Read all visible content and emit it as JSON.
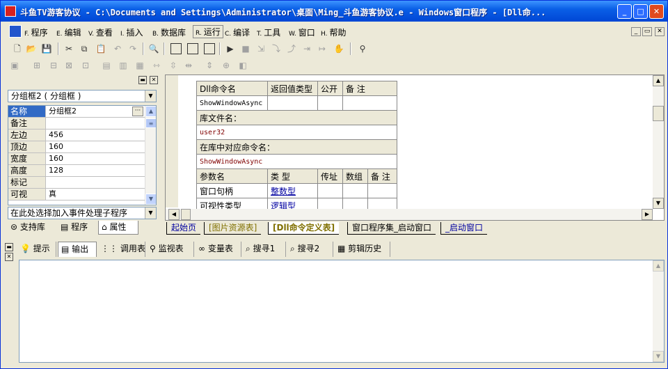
{
  "window": {
    "title": "斗鱼TV游客协议 - C:\\Documents and Settings\\Administrator\\桌面\\Ming_斗鱼游客协议.e - Windows窗口程序 - [Dll命..."
  },
  "menu": [
    {
      "key": "F.",
      "label": "程序"
    },
    {
      "key": "E.",
      "label": "编辑"
    },
    {
      "key": "V.",
      "label": "查看"
    },
    {
      "key": "I.",
      "label": "插入"
    },
    {
      "key": "B.",
      "label": "数据库"
    },
    {
      "key": "R.",
      "label": "运行"
    },
    {
      "key": "C.",
      "label": "编译"
    },
    {
      "key": "T.",
      "label": "工具"
    },
    {
      "key": "W.",
      "label": "窗口"
    },
    {
      "key": "H.",
      "label": "帮助"
    }
  ],
  "property_panel": {
    "object_selector": "分组框2 ( 分组框 )",
    "rows": [
      {
        "name": "名称",
        "value": "分组框2",
        "selected": true
      },
      {
        "name": "备注",
        "value": ""
      },
      {
        "name": "左边",
        "value": "456"
      },
      {
        "name": "顶边",
        "value": "160"
      },
      {
        "name": "宽度",
        "value": "160"
      },
      {
        "name": "高度",
        "value": "128"
      },
      {
        "name": "标记",
        "value": ""
      },
      {
        "name": "可视",
        "value": "真"
      }
    ],
    "event_selector": "在此处选择加入事件处理子程序",
    "tabs": [
      "支持库",
      "程序",
      "属性"
    ]
  },
  "dll_table": {
    "header": [
      "Dll命令名",
      "返回值类型",
      "公开",
      "备 注"
    ],
    "command_name": "ShowWindowAsync",
    "lib_label": "库文件名：",
    "lib_value": "user32",
    "lib_cmd_label": "在库中对应命令名：",
    "lib_cmd_value": "ShowWindowAsync",
    "param_header": [
      "参数名",
      "类 型",
      "传址",
      "数组",
      "备 注"
    ],
    "params": [
      {
        "name": "窗口句柄",
        "type": "整数型"
      },
      {
        "name": "可视性类型",
        "type": "逻辑型"
      }
    ]
  },
  "document_tabs": [
    {
      "label": "起始页",
      "active": false
    },
    {
      "label": "[图片资源表]",
      "active": false
    },
    {
      "label": "[Dll命令定义表]",
      "active": true
    },
    {
      "label": "窗口程序集_启动窗口",
      "active": false
    },
    {
      "label": "_启动窗口",
      "active": false
    }
  ],
  "bottom_tabs": [
    "提示",
    "输出",
    "调用表",
    "监视表",
    "变量表",
    "搜寻1",
    "搜寻2",
    "剪辑历史"
  ],
  "colors": {
    "title_bar": "#0a5fe6",
    "selection": "#316ac5",
    "link": "#0000a0",
    "string_text": "#800000"
  }
}
